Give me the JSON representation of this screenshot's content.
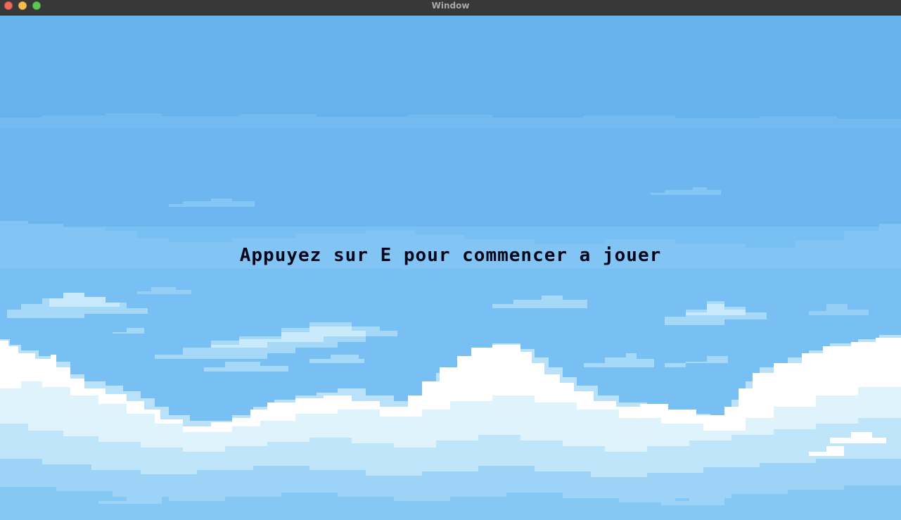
{
  "window": {
    "title": "Window"
  },
  "game": {
    "start_prompt": "Appuyez sur E pour commencer a jouer"
  },
  "colors": {
    "sky_top": "#66b2ec",
    "sky_mid": "#70b8f0",
    "sky_low": "#7cc3f5",
    "cloud_far": "#a2d6f7",
    "cloud_mid": "#c4e8fb",
    "cloud_light": "#e0f4fd",
    "cloud_white": "#ffffff",
    "text": "#06061a"
  }
}
